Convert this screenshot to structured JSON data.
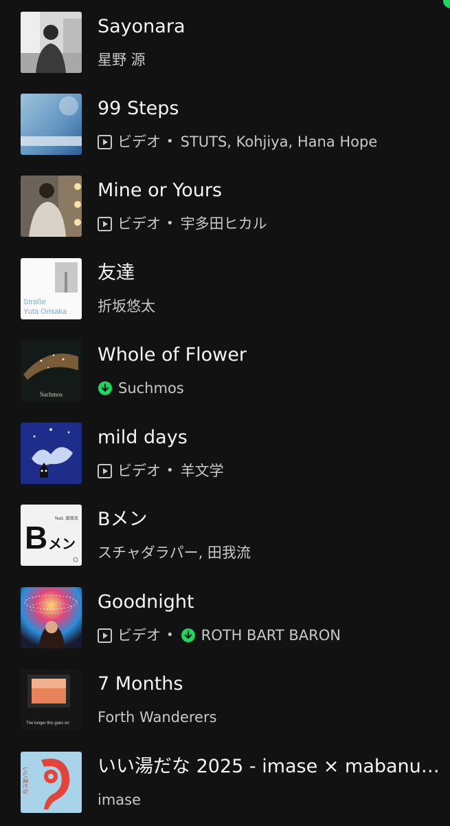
{
  "colors": {
    "background": "#121212",
    "title": "#f5f5f5",
    "subtitle": "#c9c9c9",
    "accent_green": "#1ed760"
  },
  "tracks": [
    {
      "title": "Sayonara",
      "artist": "星野 源"
    },
    {
      "title": "99 Steps",
      "type_label": "ビデオ",
      "separator": "•",
      "artist": "STUTS, Kohjiya, Hana Hope",
      "icons": [
        "video-icon"
      ]
    },
    {
      "title": "Mine or Yours",
      "type_label": "ビデオ",
      "separator": "•",
      "artist": "宇多田ヒカル",
      "icons": [
        "video-icon"
      ]
    },
    {
      "title": "友達",
      "artist": "折坂悠太",
      "art_text": [
        "Straße",
        "Yuta Orisaka"
      ]
    },
    {
      "title": "Whole of Flower",
      "artist": "Suchmos",
      "icons": [
        "download-icon"
      ],
      "art_text": [
        "Suchmos"
      ]
    },
    {
      "title": "mild days",
      "type_label": "ビデオ",
      "separator": "•",
      "artist": "羊文学",
      "icons": [
        "video-icon"
      ]
    },
    {
      "title": "Bメン",
      "artist": "スチャダラパー, 田我流",
      "art_text": [
        "B",
        "メン",
        "feat. 田我流"
      ]
    },
    {
      "title": "Goodnight",
      "type_label": "ビデオ",
      "separator": "•",
      "artist": "ROTH BART BARON",
      "icons": [
        "video-icon",
        "download-icon"
      ]
    },
    {
      "title": "7 Months",
      "artist": "Forth Wanderers",
      "art_text": [
        "The longer this goes on"
      ]
    },
    {
      "title": "いい湯だな 2025 - imase × mabanua...",
      "artist": "imase",
      "art_text": [
        "いい湯だな"
      ]
    }
  ]
}
